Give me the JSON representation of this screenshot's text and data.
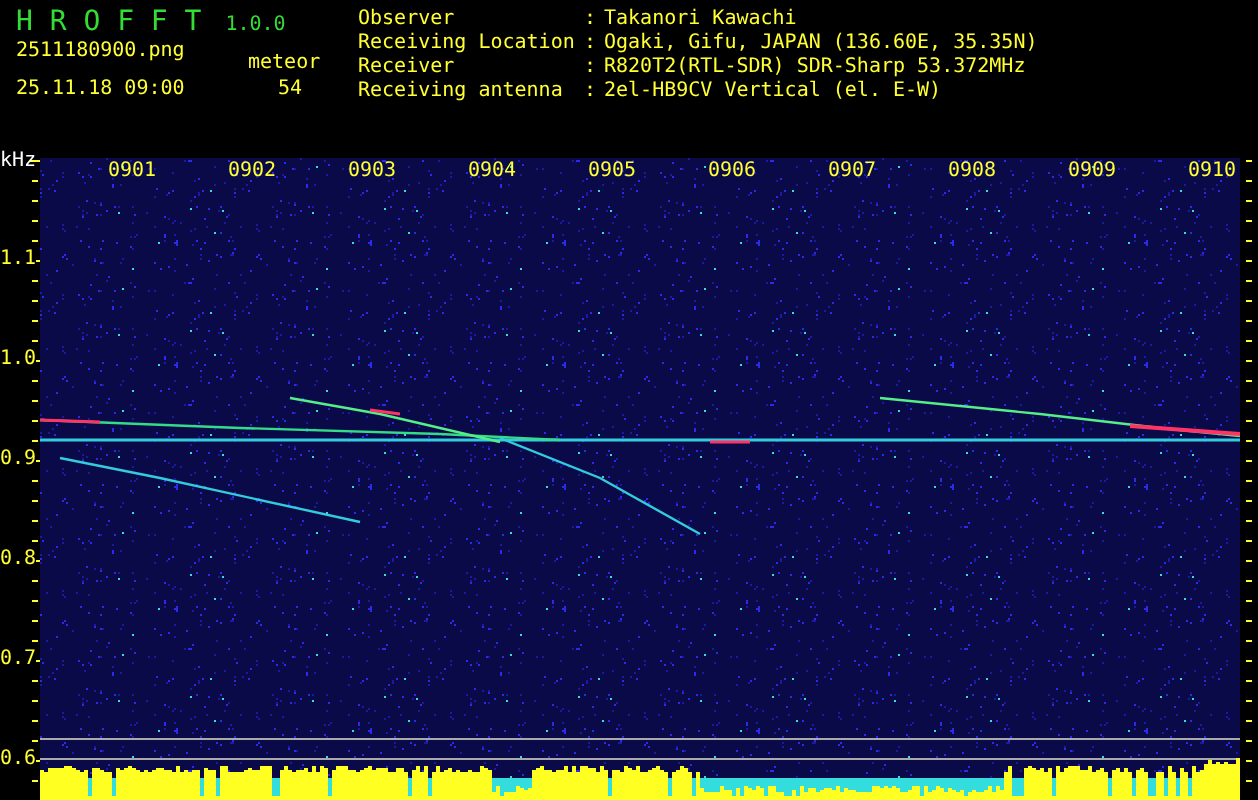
{
  "app": {
    "title": "H R O F F T",
    "version": "1.0.0"
  },
  "file_name": "2511180900.png",
  "timestamp": "25.11.18 09:00",
  "meteor_count": {
    "label": "meteor",
    "value": "54"
  },
  "info": [
    {
      "label": "Observer",
      "separator": ":",
      "value": "Takanori Kawachi"
    },
    {
      "label": "Receiving Location",
      "separator": ":",
      "value": "Ogaki, Gifu, JAPAN (136.60E, 35.35N)"
    },
    {
      "label": "Receiver",
      "separator": ":",
      "value": "R820T2(RTL-SDR) SDR-Sharp 53.372MHz"
    },
    {
      "label": "Receiving antenna",
      "separator": ":",
      "value": "2el-HB9CV Vertical (el. E-W)"
    }
  ],
  "y_axis": {
    "unit": "kHz",
    "labels": [
      "1.1",
      "1.0",
      "0.9",
      "0.8",
      "0.7",
      "0.6"
    ]
  },
  "time_labels": [
    "0901",
    "0902",
    "0903",
    "0904",
    "0905",
    "0906",
    "0907",
    "0908",
    "0909",
    "0910"
  ]
}
